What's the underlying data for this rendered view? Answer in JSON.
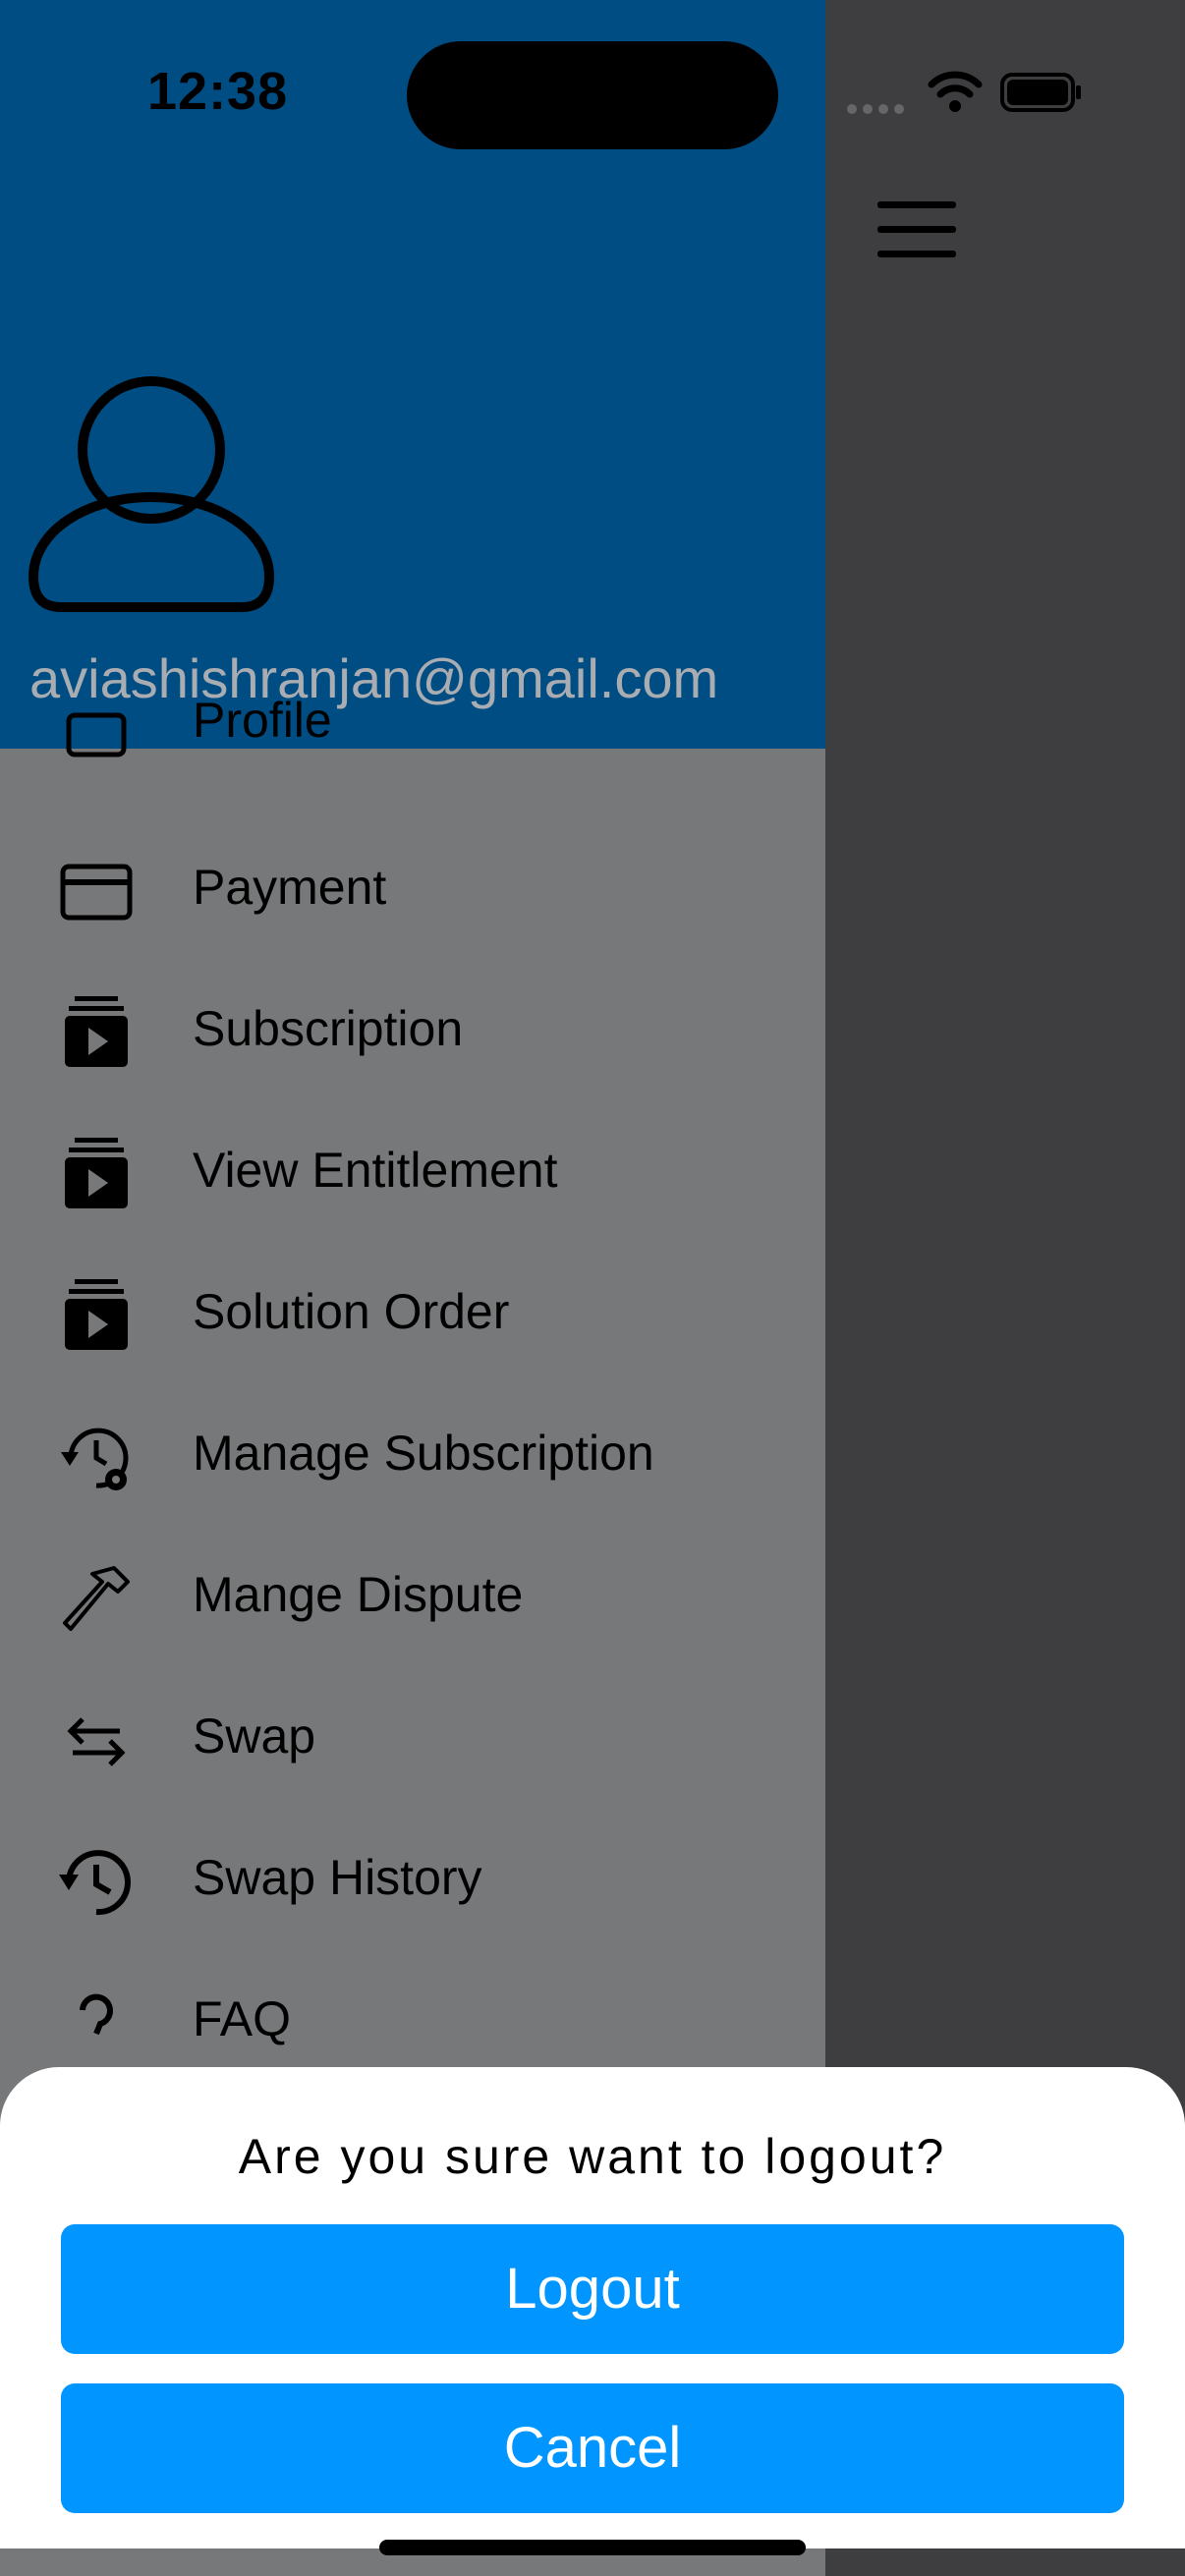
{
  "status_bar": {
    "time": "12:38"
  },
  "drawer": {
    "email": "aviashishranjan@gmail.com",
    "partial_top_label": "Profile",
    "items": [
      {
        "label": "Payment",
        "icon": "credit-card-icon"
      },
      {
        "label": "Subscription",
        "icon": "subscription-icon"
      },
      {
        "label": "View Entitlement",
        "icon": "subscription-icon"
      },
      {
        "label": "Solution Order",
        "icon": "subscription-icon"
      },
      {
        "label": "Manage Subscription",
        "icon": "manage-history-icon"
      },
      {
        "label": "Mange Dispute",
        "icon": "gavel-icon"
      },
      {
        "label": "Swap",
        "icon": "swap-arrows-icon"
      },
      {
        "label": "Swap History",
        "icon": "history-icon"
      },
      {
        "label": "FAQ",
        "icon": "help-icon"
      }
    ]
  },
  "dialog": {
    "title": "Are you sure want to logout?",
    "logout_label": "Logout",
    "cancel_label": "Cancel"
  },
  "colors": {
    "header": "#004d84",
    "overlay": "#77787a",
    "button": "#0095ff",
    "email_text": "#a9adb2"
  }
}
